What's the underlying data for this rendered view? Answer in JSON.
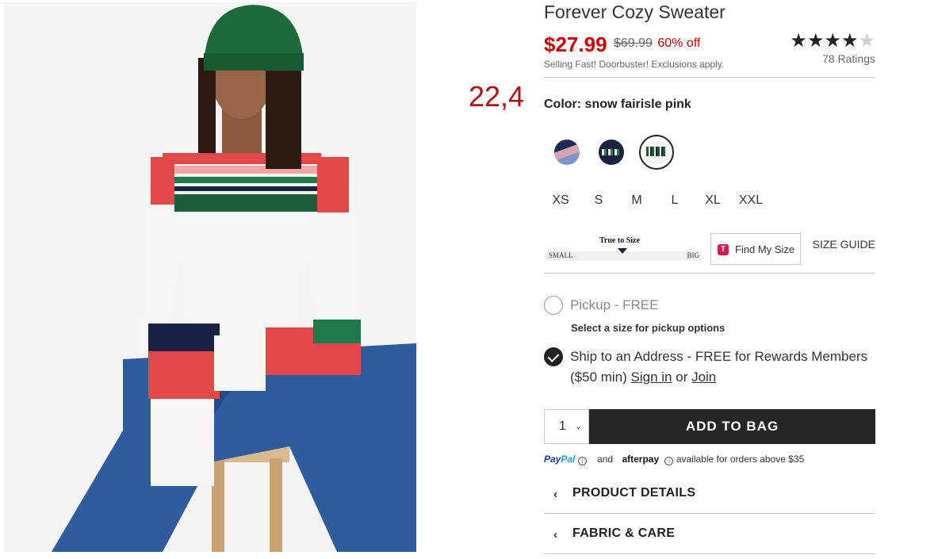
{
  "product": {
    "title": "Forever Cozy Sweater",
    "price_current": "$27.99",
    "price_original": "$69.99",
    "discount": "60% off",
    "selling_note": "Selling Fast! Doorbuster! Exclusions apply."
  },
  "rating": {
    "stars_filled": "★★★★",
    "stars_empty": "★",
    "value": 4,
    "max": 5,
    "count_label": "78 Ratings"
  },
  "overlay_number": "22,4",
  "color": {
    "label": "Color: snow fairisle pink",
    "swatches": [
      "navy-pink-stripe-swatch",
      "navy-fairisle-swatch",
      "snow-fairisle-swatch"
    ],
    "selected_index": 2
  },
  "sizes": [
    "XS",
    "S",
    "M",
    "L",
    "XL",
    "XXL"
  ],
  "fit": {
    "title": "True to Size",
    "small": "SMALL",
    "big": "BIG"
  },
  "find_my_size": {
    "logo": "T",
    "label": "Find My Size"
  },
  "size_guide": "SIZE GUIDE",
  "pickup": {
    "label": "Pickup - FREE",
    "note": "Select a size for pickup options"
  },
  "ship": {
    "label_start": "Ship to an Address",
    "label_rest": " - FREE for Rewards Members ($50 min) ",
    "sign_in": "Sign in",
    "or": " or ",
    "join": "Join"
  },
  "quantity": {
    "value": "1",
    "chevron": "⌄"
  },
  "add_to_bag": "ADD TO BAG",
  "payment": {
    "paypal_a": "Pay",
    "paypal_b": "Pal",
    "and": "and",
    "afterpay": "afterpay",
    "note": "available for orders above $35",
    "info": "i"
  },
  "accordions": [
    {
      "label": "PRODUCT DETAILS"
    },
    {
      "label": "FABRIC & CARE"
    }
  ],
  "colors": {
    "price_red": "#d00000",
    "button_dark": "#262626",
    "overlay_red": "#b01212"
  }
}
